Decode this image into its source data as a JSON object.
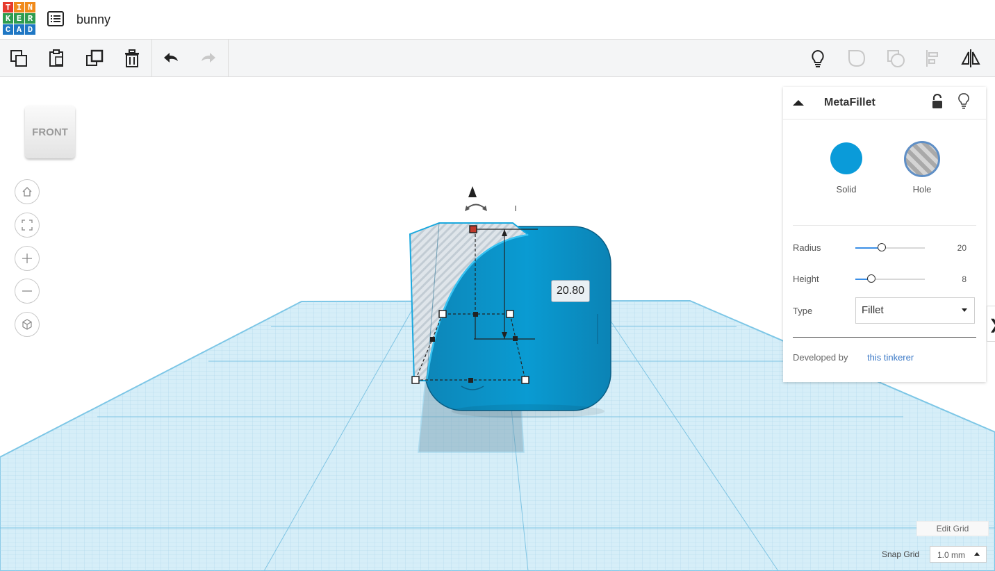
{
  "app": {
    "logo_letters": [
      "T",
      "I",
      "N",
      "K",
      "E",
      "R",
      "C",
      "A",
      "D"
    ],
    "logo_colors": [
      "#e63b2e",
      "#f08a1b",
      "#f08a1b",
      "#2e9c4f",
      "#2e9c4f",
      "#2e9c4f",
      "#1f77c4",
      "#1f77c4",
      "#1f77c4"
    ],
    "design_title": "bunny"
  },
  "toolbar": {
    "left_icons": [
      "copy-icon",
      "paste-icon",
      "duplicate-icon",
      "delete-icon",
      "undo-icon",
      "redo-icon"
    ],
    "right_icons": [
      "lightbulb-icon",
      "group-icon",
      "ungroup-icon",
      "align-icon",
      "mirror-icon"
    ]
  },
  "viewcube": {
    "face_label": "FRONT"
  },
  "nav": {
    "icons": [
      "home-icon",
      "fit-view-icon",
      "zoom-in-icon",
      "zoom-out-icon",
      "perspective-icon"
    ]
  },
  "dimension": {
    "value": "20.80"
  },
  "inspector": {
    "title": "MetaFillet",
    "solid_label": "Solid",
    "hole_label": "Hole",
    "solid_color": "#0a9bd9",
    "radius_label": "Radius",
    "radius_value": "20",
    "radius_fraction": 0.38,
    "height_label": "Height",
    "height_value": "8",
    "height_fraction": 0.23,
    "type_label": "Type",
    "type_value": "Fillet",
    "developed_by_label": "Developed by",
    "developer_link": "this tinkerer"
  },
  "grid": {
    "edit_grid_label": "Edit Grid",
    "snap_grid_label": "Snap Grid",
    "snap_grid_value": "1.0 mm"
  }
}
